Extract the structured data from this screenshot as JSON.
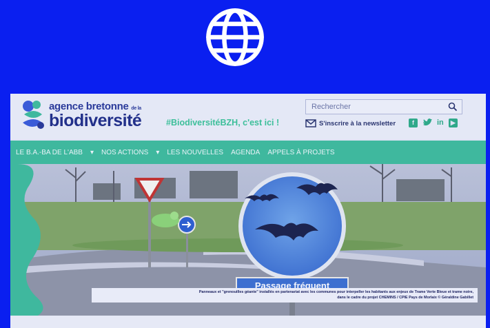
{
  "globe_icon": "globe-icon",
  "site": {
    "logo": {
      "line1": "agence bretonne",
      "line1_small": "de la",
      "line2": "biodiversité",
      "colors": [
        "#3a5bd8",
        "#3fb89e",
        "#2a3a9a"
      ]
    },
    "hashtag": "#BiodiversitéBZH, c'est ici !",
    "search": {
      "placeholder": "Rechercher"
    },
    "newsletter": "S'inscrire à la newsletter",
    "socials": [
      "facebook",
      "twitter",
      "linkedin",
      "youtube"
    ],
    "nav": [
      "LE B.A.-BA DE L'ABB",
      "NOS ACTIONS",
      "LES NOUVELLES",
      "AGENDA",
      "APPELS À PROJETS"
    ],
    "hero": {
      "sign_text": "Passage fréquent",
      "caption_line1": "Panneaux et \"grenouilles géante\" installés en partenariat avec les communes pour interpeller les habitants aux enjeux de Trame Verte Bleue et trame noire,",
      "caption_line2": "dans le cadre du projet CHEMINS / CPIE Pays de Morlaix © Géraldine Gabillet"
    },
    "accent_color": "#3fb89e",
    "page_background": "#0a1ff0"
  }
}
